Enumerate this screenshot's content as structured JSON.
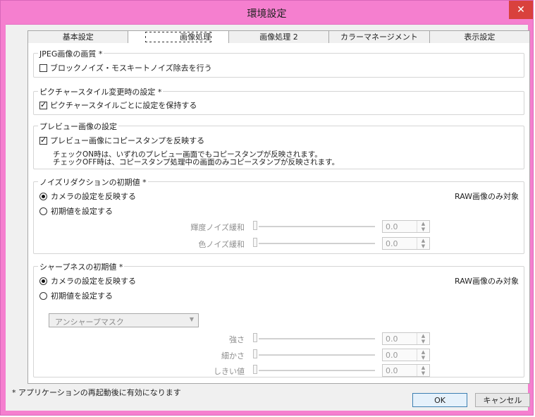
{
  "window": {
    "title": "環境設定",
    "close_symbol": "✕"
  },
  "tabs": [
    {
      "label": "基本設定",
      "active": false
    },
    {
      "label": "画像処理 1",
      "active": true
    },
    {
      "label": "画像処理 2",
      "active": false
    },
    {
      "label": "カラーマネージメント",
      "active": false
    },
    {
      "label": "表示設定",
      "active": false
    }
  ],
  "jpeg_group": {
    "legend": "JPEG画像の画質 *",
    "checkbox_label": "ブロックノイズ・モスキートノイズ除去を行う",
    "checked": false
  },
  "picture_style_group": {
    "legend": "ピクチャースタイル変更時の設定 *",
    "checkbox_label": "ピクチャースタイルごとに設定を保持する",
    "checked": true
  },
  "preview_group": {
    "legend": "プレビュー画像の設定",
    "checkbox_label": "プレビュー画像にコピースタンプを反映する",
    "checked": true,
    "note_line1": "チェックON時は、いずれのプレビュー画面でもコピースタンプが反映されます。",
    "note_line2": "チェックOFF時は、コピースタンプ処理中の画面のみコピースタンプが反映されます。"
  },
  "noise_group": {
    "legend": "ノイズリダクションの初期値 *",
    "radio1": "カメラの設定を反映する",
    "radio2": "初期値を設定する",
    "selected": "radio1",
    "raw_only": "RAW画像のみ対象",
    "sliders": [
      {
        "label": "輝度ノイズ緩和",
        "value": "0.0"
      },
      {
        "label": "色ノイズ緩和",
        "value": "0.0"
      }
    ]
  },
  "sharpness_group": {
    "legend": "シャープネスの初期値 *",
    "radio1": "カメラの設定を反映する",
    "radio2": "初期値を設定する",
    "selected": "radio1",
    "raw_only": "RAW画像のみ対象",
    "select_value": "アンシャープマスク",
    "sliders": [
      {
        "label": "強さ",
        "value": "0.0"
      },
      {
        "label": "細かさ",
        "value": "0.0"
      },
      {
        "label": "しきい値",
        "value": "0.0"
      }
    ]
  },
  "footer": {
    "note": "* アプリケーションの再起動後に有効になります",
    "ok_label": "OK",
    "cancel_label": "キャンセル"
  },
  "colors": {
    "titlebar": "#f57fcf",
    "close": "#d9413d",
    "ok_border": "#3c7fb1"
  }
}
